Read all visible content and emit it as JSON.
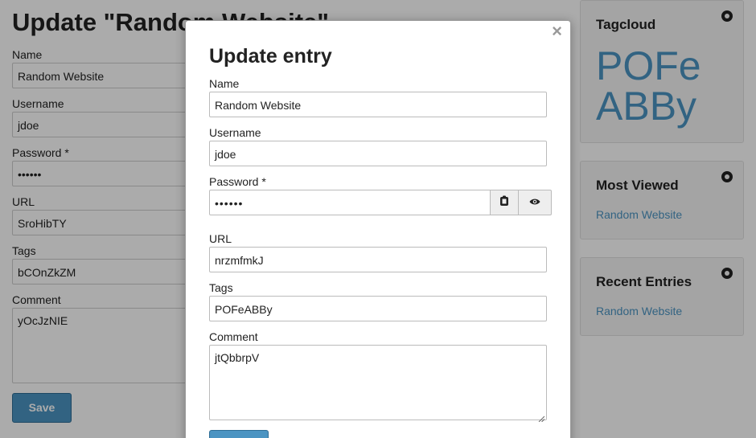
{
  "background": {
    "title": "Update \"Random Website\"",
    "fields": {
      "name": {
        "label": "Name",
        "value": "Random Website"
      },
      "username": {
        "label": "Username",
        "value": "jdoe"
      },
      "password": {
        "label": "Password *",
        "value": "••••••"
      },
      "url": {
        "label": "URL",
        "value": "SroHibTY"
      },
      "tags": {
        "label": "Tags",
        "value": "bCOnZkZM"
      },
      "comment": {
        "label": "Comment",
        "value": "yOcJzNIE"
      }
    },
    "save_label": "Save"
  },
  "sidebar": {
    "tagcloud": {
      "title": "Tagcloud",
      "tag": "POFeABBy",
      "tag_line1": "POFe",
      "tag_line2": "ABBy"
    },
    "most_viewed": {
      "title": "Most Viewed",
      "items": [
        "Random Website"
      ]
    },
    "recent_entries": {
      "title": "Recent Entries",
      "items": [
        "Random Website"
      ]
    }
  },
  "modal": {
    "title": "Update entry",
    "close_symbol": "×",
    "fields": {
      "name": {
        "label": "Name",
        "value": "Random Website"
      },
      "username": {
        "label": "Username",
        "value": "jdoe"
      },
      "password": {
        "label": "Password *",
        "value": "••••••"
      },
      "url": {
        "label": "URL",
        "value": "nrzmfmkJ"
      },
      "tags": {
        "label": "Tags",
        "value": "POFeABBy"
      },
      "comment": {
        "label": "Comment",
        "value": "jtQbbrpV"
      }
    },
    "icons": {
      "copy": "clipboard-icon",
      "reveal": "eye-icon",
      "gear": "gear-icon"
    }
  },
  "colors": {
    "accent": "#4b94c2",
    "overlay": "rgba(0,0,0,0.33)"
  }
}
